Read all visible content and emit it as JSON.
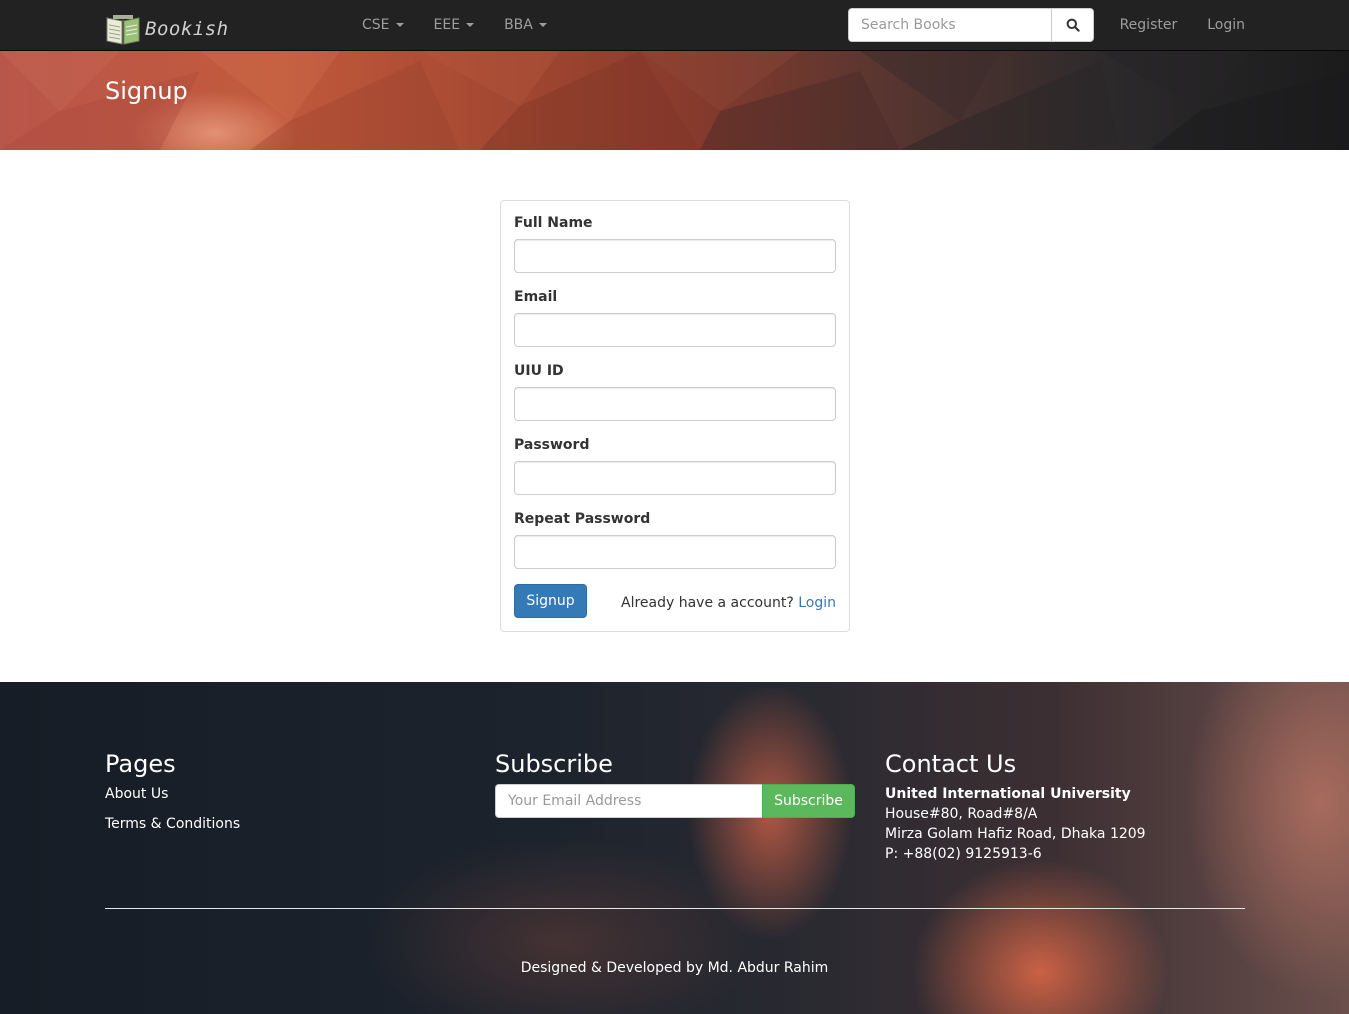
{
  "navbar": {
    "brand": "Bookish",
    "menu": [
      {
        "label": "CSE"
      },
      {
        "label": "EEE"
      },
      {
        "label": "BBA"
      }
    ],
    "search_placeholder": "Search Books",
    "register": "Register",
    "login": "Login"
  },
  "hero": {
    "title": "Signup"
  },
  "form": {
    "fields": [
      {
        "label": "Full Name"
      },
      {
        "label": "Email"
      },
      {
        "label": "UIU ID"
      },
      {
        "label": "Password"
      },
      {
        "label": "Repeat Password"
      }
    ],
    "submit": "Signup",
    "already_text": "Already have a account?",
    "login_link": "Login"
  },
  "footer": {
    "pages_title": "Pages",
    "pages_links": [
      "About Us",
      "Terms & Conditions"
    ],
    "subscribe_title": "Subscribe",
    "subscribe_placeholder": "Your Email Address",
    "subscribe_button": "Subscribe",
    "contact_title": "Contact Us",
    "contact_org": "United International University",
    "contact_address1": "House#80, Road#8/A",
    "contact_address2": "Mirza Golam Hafiz Road, Dhaka 1209",
    "contact_phone": "P: +88(02) 9125913-6",
    "credit": "Designed & Developed by Md. Abdur Rahim"
  },
  "colors": {
    "navbar_bg": "#222222",
    "primary": "#337ab7",
    "success": "#5cb85c"
  }
}
